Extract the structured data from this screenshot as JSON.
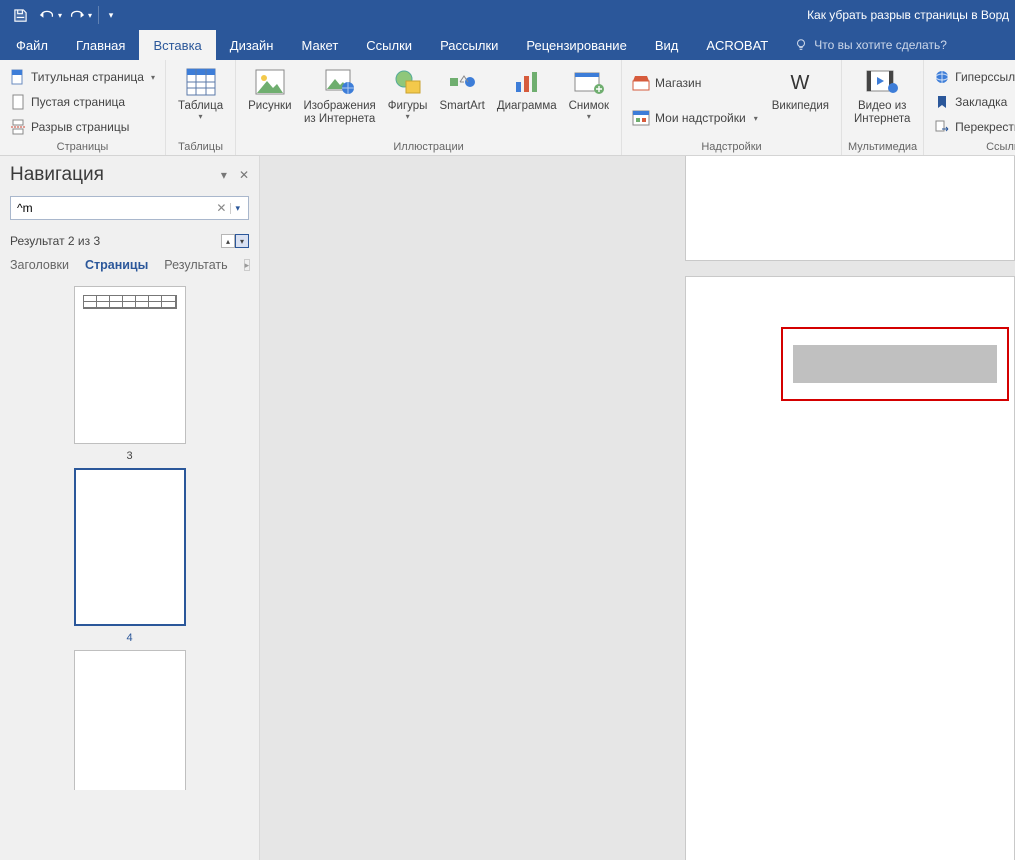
{
  "titlebar": {
    "doc_title": "Как убрать разрыв страницы в Ворд"
  },
  "tabs": {
    "file": "Файл",
    "home": "Главная",
    "insert": "Вставка",
    "design": "Дизайн",
    "layout": "Макет",
    "references": "Ссылки",
    "mailings": "Рассылки",
    "review": "Рецензирование",
    "view": "Вид",
    "acrobat": "ACROBAT",
    "tell_me": "Что вы хотите сделать?"
  },
  "ribbon": {
    "pages": {
      "title_page": "Титульная страница",
      "blank_page": "Пустая страница",
      "page_break": "Разрыв страницы",
      "group_label": "Страницы"
    },
    "tables": {
      "table": "Таблица",
      "group_label": "Таблицы"
    },
    "illustrations": {
      "pictures": "Рисунки",
      "online_pictures_l1": "Изображения",
      "online_pictures_l2": "из Интернета",
      "shapes": "Фигуры",
      "smartart": "SmartArt",
      "chart": "Диаграмма",
      "screenshot": "Снимок",
      "group_label": "Иллюстрации"
    },
    "addins": {
      "store": "Магазин",
      "my_addins": "Мои надстройки",
      "wikipedia": "Википедия",
      "group_label": "Надстройки"
    },
    "media": {
      "online_video_l1": "Видео из",
      "online_video_l2": "Интернета",
      "group_label": "Мультимедиа"
    },
    "links": {
      "hyperlink": "Гиперссылка",
      "bookmark": "Закладка",
      "crossref": "Перекрестная ссылка",
      "group_label": "Ссылки"
    }
  },
  "nav": {
    "title": "Навигация",
    "search_value": "^m",
    "result": "Результат 2 из 3",
    "tab_headings": "Заголовки",
    "tab_pages": "Страницы",
    "tab_results": "Результать",
    "thumbs": [
      {
        "num": "3",
        "has_table": true,
        "selected": false
      },
      {
        "num": "4",
        "has_table": false,
        "selected": true
      },
      {
        "num": "",
        "has_table": false,
        "selected": false
      }
    ]
  }
}
